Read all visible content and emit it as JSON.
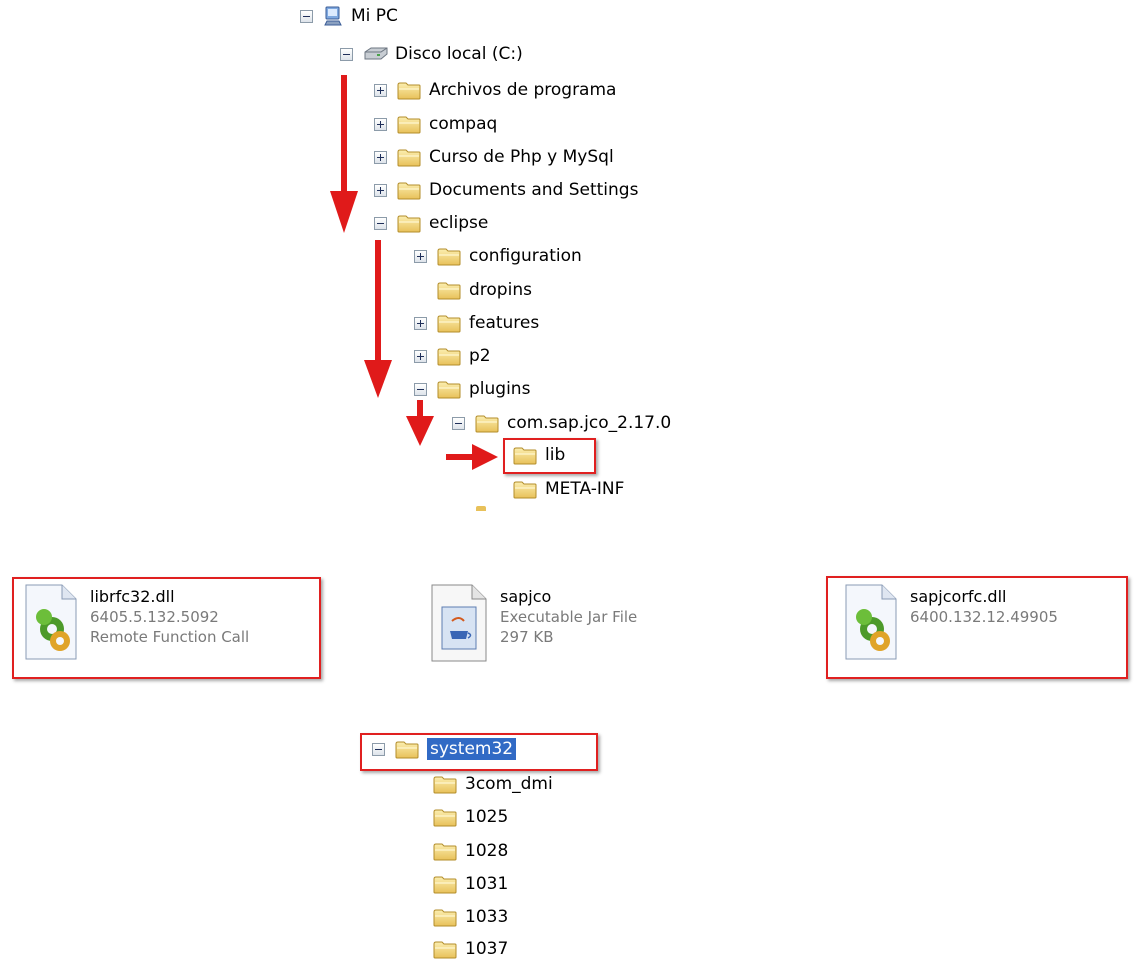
{
  "tree": {
    "my_pc": {
      "label": "Mi PC",
      "icon": "computer-icon"
    },
    "drive": {
      "label": "Disco local (C:)",
      "icon": "hard-drive-icon"
    },
    "c_items": [
      {
        "label": "Archivos de programa",
        "expander": "plus"
      },
      {
        "label": "compaq",
        "expander": "plus"
      },
      {
        "label": "Curso de Php y MySql",
        "expander": "plus"
      },
      {
        "label": "Documents and Settings",
        "expander": "plus"
      },
      {
        "label": "eclipse",
        "expander": "minus"
      }
    ],
    "eclipse_items": [
      {
        "label": "configuration",
        "expander": "plus"
      },
      {
        "label": "dropins",
        "expander": "none"
      },
      {
        "label": "features",
        "expander": "plus"
      },
      {
        "label": "p2",
        "expander": "plus"
      },
      {
        "label": "plugins",
        "expander": "minus"
      }
    ],
    "plugin": {
      "label": "com.sap.jco_2.17.0"
    },
    "plugin_items": [
      {
        "label": "lib",
        "highlighted": true
      },
      {
        "label": "META-INF",
        "highlighted": false
      }
    ]
  },
  "files": [
    {
      "name": "librfc32.dll",
      "line2": "6405.5.132.5092",
      "line3": "Remote Function Call",
      "icon": "dll-gear-icon",
      "highlighted": true
    },
    {
      "name": "sapjco",
      "line2": "Executable Jar File",
      "line3": "297 KB",
      "icon": "java-jar-icon",
      "highlighted": false
    },
    {
      "name": "sapjcorfc.dll",
      "line2": "6400.132.12.49905",
      "line3": "",
      "icon": "dll-gear-icon",
      "highlighted": true
    }
  ],
  "system32_tree": {
    "root": {
      "label": "system32",
      "selected": true
    },
    "items": [
      "3com_dmi",
      "1025",
      "1028",
      "1031",
      "1033",
      "1037"
    ]
  },
  "colors": {
    "arrow": "#e01a1a",
    "highlight_box": "#e02020",
    "selection": "#316ac5",
    "folder": "#f2d675"
  }
}
